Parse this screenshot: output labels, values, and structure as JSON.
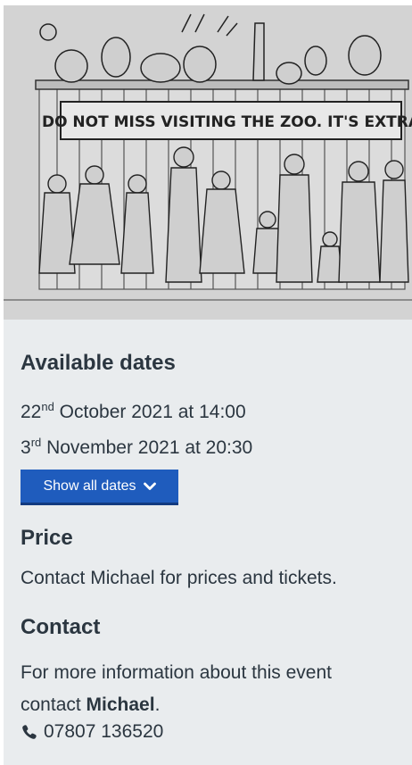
{
  "hero": {
    "image_icon": "vintage-zoo-cartoon-illustration",
    "sign_text": "DO NOT MISS VISITING THE ZOO.  IT'S EXTRA"
  },
  "dates": {
    "heading": "Available dates",
    "items": [
      {
        "day": "22",
        "suffix": "nd",
        "rest": " October 2021 at 14:00"
      },
      {
        "day": "3",
        "suffix": "rd",
        "rest": " November 2021 at 20:30"
      }
    ],
    "show_all_label": "Show all dates",
    "show_all_icon": "chevron-down-icon"
  },
  "price": {
    "heading": "Price",
    "text": "Contact Michael for prices and tickets."
  },
  "contact": {
    "heading": "Contact",
    "text_before": "For more information about this event contact ",
    "name": "Michael",
    "text_after": ".",
    "phone_icon": "phone-icon",
    "phone": "07807 136520"
  },
  "colors": {
    "card_bg": "#e9ecee",
    "text": "#2b3640",
    "button_bg": "#1f5cbd",
    "button_text": "#ffffff"
  }
}
